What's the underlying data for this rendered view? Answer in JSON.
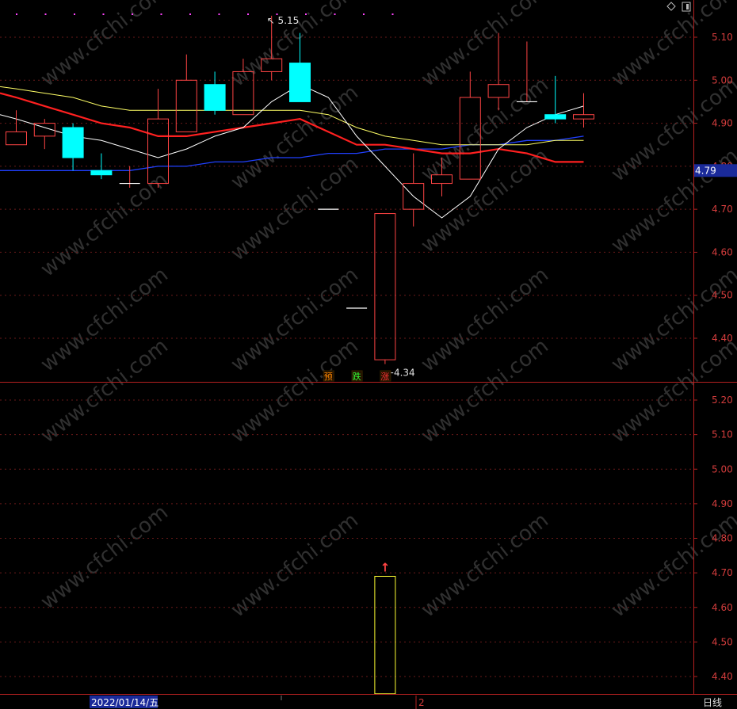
{
  "colors": {
    "up": "#ff4444",
    "down": "#00ffff",
    "ma5": "#ffffff",
    "ma10": "#ffff66",
    "ma20": "#ff2020",
    "ma60": "#2040ff",
    "axis": "#b42020",
    "grid": "#6a1a1a",
    "volume_box": "#ffff33",
    "date_bg": "#1a2a9a"
  },
  "chart_data": [
    {
      "type": "candlestick",
      "name": "main",
      "ylim": [
        4.32,
        5.16
      ],
      "yticks": [
        "5.10",
        "5.00",
        "4.90",
        "4.80",
        "4.70",
        "4.60",
        "4.50",
        "4.40"
      ],
      "current_price_label": "4.79",
      "high_label": "5.15",
      "low_label": "4.34",
      "high_arrow": "↖",
      "low_arrow": "←",
      "candles": [
        {
          "o": 4.85,
          "c": 4.88,
          "h": 4.93,
          "l": 4.85
        },
        {
          "o": 4.87,
          "c": 4.9,
          "h": 4.91,
          "l": 4.84
        },
        {
          "o": 4.89,
          "c": 4.82,
          "h": 4.9,
          "l": 4.79
        },
        {
          "o": 4.79,
          "c": 4.78,
          "h": 4.83,
          "l": 4.77
        },
        {
          "o": 4.76,
          "c": 4.76,
          "h": 4.8,
          "l": 4.75
        },
        {
          "o": 4.76,
          "c": 4.91,
          "h": 4.98,
          "l": 4.75
        },
        {
          "o": 4.88,
          "c": 5.0,
          "h": 5.06,
          "l": 4.88
        },
        {
          "o": 4.99,
          "c": 4.93,
          "h": 5.02,
          "l": 4.92
        },
        {
          "o": 4.92,
          "c": 5.02,
          "h": 5.05,
          "l": 4.92
        },
        {
          "o": 5.02,
          "c": 5.05,
          "h": 5.15,
          "l": 5.0
        },
        {
          "o": 5.04,
          "c": 4.95,
          "h": 5.11,
          "l": 4.95
        },
        {
          "o": 4.7,
          "c": 4.7,
          "h": 4.7,
          "l": 4.7
        },
        {
          "o": 4.47,
          "c": 4.47,
          "h": 4.47,
          "l": 4.47
        },
        {
          "o": 4.35,
          "c": 4.69,
          "h": 4.69,
          "l": 4.34
        },
        {
          "o": 4.7,
          "c": 4.76,
          "h": 4.83,
          "l": 4.66
        },
        {
          "o": 4.76,
          "c": 4.78,
          "h": 4.82,
          "l": 4.73
        },
        {
          "o": 4.77,
          "c": 4.96,
          "h": 5.02,
          "l": 4.77
        },
        {
          "o": 4.96,
          "c": 4.99,
          "h": 5.11,
          "l": 4.93
        },
        {
          "o": 4.95,
          "c": 4.95,
          "h": 5.09,
          "l": 4.95
        },
        {
          "o": 4.92,
          "c": 4.91,
          "h": 5.01,
          "l": 4.9
        },
        {
          "o": 4.91,
          "c": 4.92,
          "h": 4.97,
          "l": 4.89
        }
      ],
      "ma5": [
        4.91,
        4.89,
        4.87,
        4.86,
        4.84,
        4.82,
        4.84,
        4.87,
        4.89,
        4.95,
        4.99,
        4.96,
        4.87,
        4.8,
        4.73,
        4.68,
        4.73,
        4.84,
        4.89,
        4.92,
        4.94
      ],
      "ma10": [
        4.98,
        4.97,
        4.96,
        4.94,
        4.93,
        4.93,
        4.93,
        4.93,
        4.93,
        4.93,
        4.93,
        4.92,
        4.89,
        4.87,
        4.86,
        4.85,
        4.85,
        4.85,
        4.85,
        4.86,
        4.86
      ],
      "ma20": [
        4.96,
        4.94,
        4.92,
        4.9,
        4.89,
        4.87,
        4.87,
        4.88,
        4.89,
        4.9,
        4.91,
        4.88,
        4.85,
        4.85,
        4.84,
        4.83,
        4.83,
        4.84,
        4.83,
        4.81,
        4.81
      ],
      "ma60": [
        4.79,
        4.79,
        4.79,
        4.79,
        4.79,
        4.8,
        4.8,
        4.81,
        4.81,
        4.82,
        4.82,
        4.83,
        4.83,
        4.84,
        4.84,
        4.84,
        4.85,
        4.85,
        4.86,
        4.86,
        4.87
      ],
      "badges": [
        {
          "text": "预",
          "color": "#ff8800",
          "index": 11
        },
        {
          "text": "跌",
          "color": "#33ff33",
          "index": 12
        },
        {
          "text": "涨",
          "color": "#ff3333",
          "index": 13
        }
      ]
    },
    {
      "type": "bar",
      "name": "sub",
      "ylim": [
        4.35,
        5.24
      ],
      "yticks": [
        "5.20",
        "5.10",
        "5.00",
        "4.90",
        "4.80",
        "4.70",
        "4.60",
        "4.50",
        "4.40"
      ],
      "bars": [
        {
          "index": 13,
          "low": 4.35,
          "high": 4.69
        }
      ],
      "marker": "↑"
    }
  ],
  "bottom_bar": {
    "date": "2022/01/14/五",
    "marker": "2",
    "period": "日线"
  },
  "watermark": "www.cfchi.com"
}
